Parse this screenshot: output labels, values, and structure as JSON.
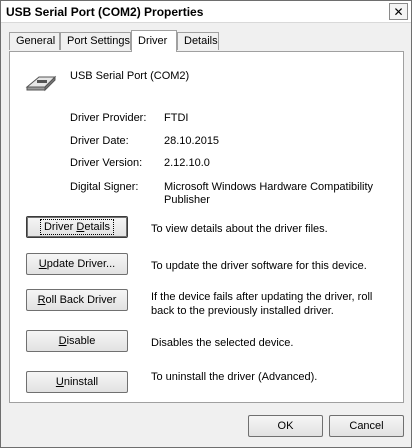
{
  "window": {
    "title": "USB Serial Port (COM2) Properties",
    "close_glyph": "✕"
  },
  "tabs": [
    {
      "label": "General",
      "active": false
    },
    {
      "label": "Port Settings",
      "active": false
    },
    {
      "label": "Driver",
      "active": true
    },
    {
      "label": "Details",
      "active": false
    }
  ],
  "device": {
    "name": "USB Serial Port (COM2)",
    "icon": "serial-cable-icon"
  },
  "info": [
    {
      "label": "Driver Provider:",
      "value": "FTDI"
    },
    {
      "label": "Driver Date:",
      "value": "28.10.2015"
    },
    {
      "label": "Driver Version:",
      "value": "2.12.10.0"
    },
    {
      "label": "Digital Signer:",
      "value": "Microsoft Windows Hardware Compatibility Publisher"
    }
  ],
  "actions": [
    {
      "pre": "Driver ",
      "ul": "D",
      "post": "etails",
      "desc": "To view details about the driver files."
    },
    {
      "pre": "",
      "ul": "U",
      "post": "pdate Driver...",
      "desc": "To update the driver software for this device."
    },
    {
      "pre": "",
      "ul": "R",
      "post": "oll Back Driver",
      "desc": "If the device fails after updating the driver, roll back to the previously installed driver."
    },
    {
      "pre": "",
      "ul": "D",
      "post": "isable",
      "desc": "Disables the selected device."
    },
    {
      "pre": "",
      "ul": "U",
      "post": "ninstall",
      "desc": "To uninstall the driver (Advanced)."
    }
  ],
  "footer": {
    "ok": "OK",
    "cancel": "Cancel"
  }
}
